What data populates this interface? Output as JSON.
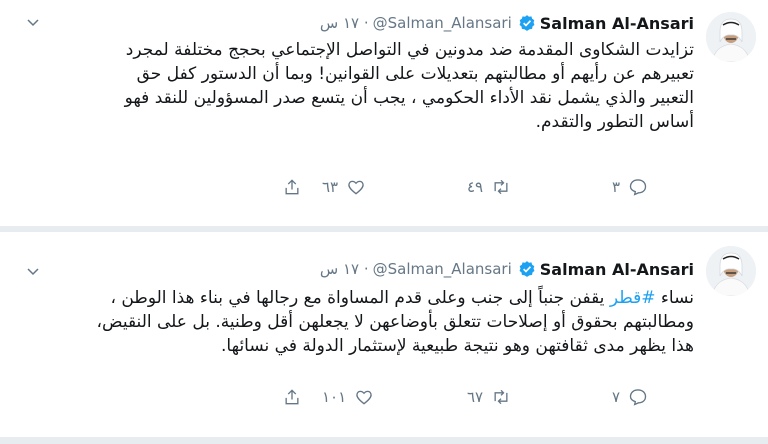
{
  "tweets": [
    {
      "name": "Salman Al-Ansari",
      "handle": "@Salman_Alansari",
      "time": "· ١٧ س",
      "text": "تزايدت الشكاوى المقدمة ضد مدونين في التواصل الإجتماعي بحجج مختلفة لمجرد تعبيرهم عن رأيهم أو مطالبتهم بتعديلات على القوانين! وبما أن الدستور كفل حق التعبير والذي يشمل نقد الأداء الحكومي ، يجب أن يتسع صدر المسؤولين للنقد فهو أساس التطور والتقدم.",
      "replies": "٣",
      "retweets": "٤٩",
      "likes": "٦٣"
    },
    {
      "name": "Salman Al-Ansari",
      "handle": "@Salman_Alansari",
      "time": "· ١٧ س",
      "text_before": "نساء ",
      "hashtag": "#قطر",
      "text_after": " يقفن جنباً إلى جنب وعلى قدم المساواة مع رجالها في بناء هذا الوطن ، ومطالبتهم بحقوق أو إصلاحات تتعلق بأوضاعهن لا يجعلهن أقل وطنية. بل على النقيض، هذا يظهر مدى ثقافتهن وهو نتيجة طبيعية لإستثمار الدولة في نسائها.",
      "replies": "٧",
      "retweets": "٦٧",
      "likes": "١٠١"
    }
  ],
  "icons": {
    "verified": "verified-badge-icon",
    "chevron": "chevron-down-icon",
    "reply": "reply-icon",
    "retweet": "retweet-icon",
    "like": "heart-icon",
    "share": "share-icon"
  },
  "colors": {
    "accent": "#1da1f2",
    "muted": "#657786",
    "separator": "#e6ecf0"
  }
}
